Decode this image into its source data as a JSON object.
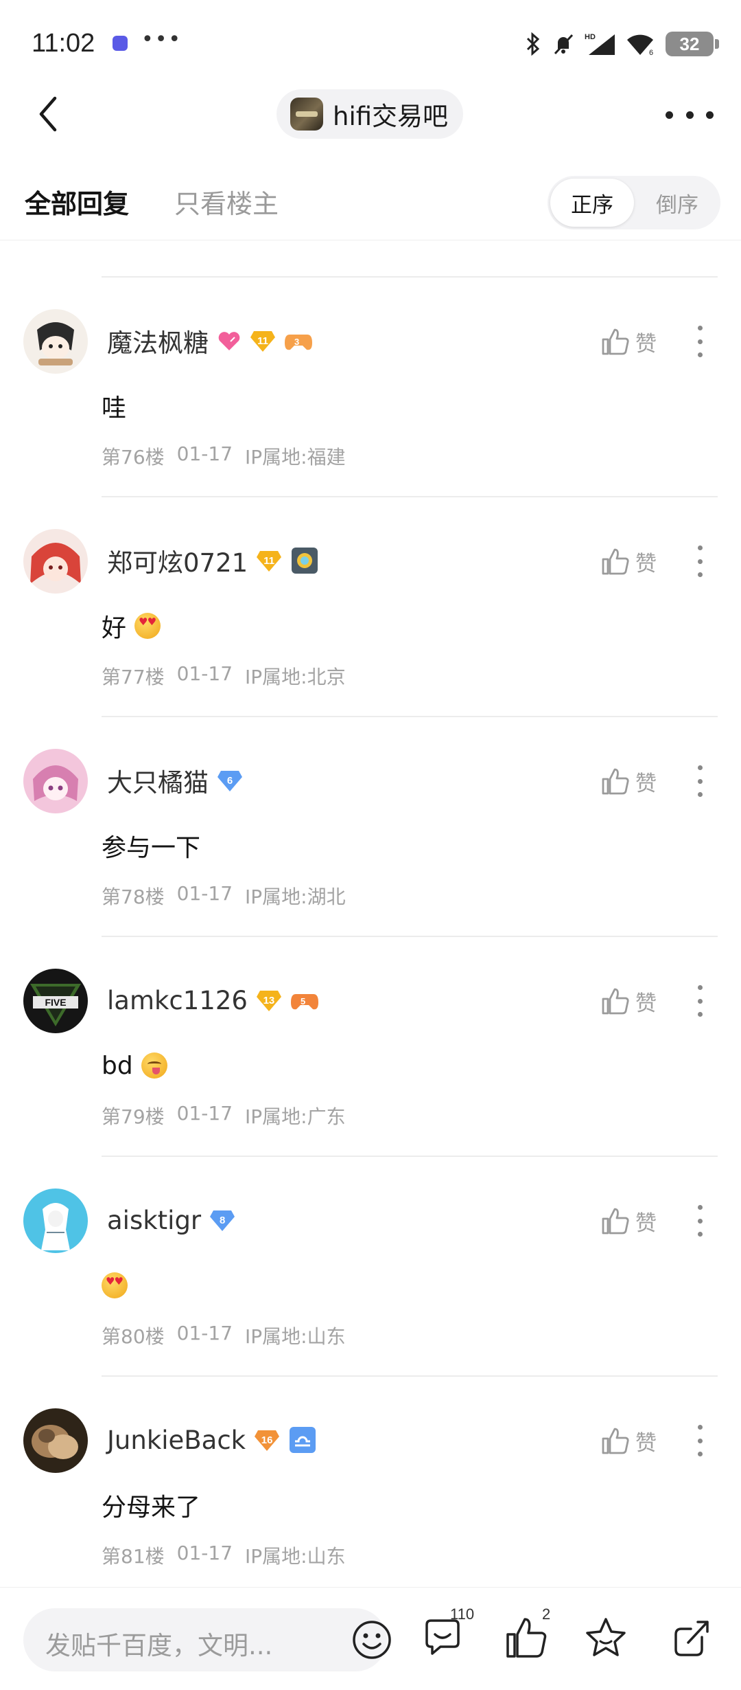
{
  "status_bar": {
    "time": "11:02",
    "dots": "•••",
    "battery": "32"
  },
  "nav": {
    "forum_name": "hifi交易吧"
  },
  "tabs": {
    "all_replies": "全部回复",
    "op_only": "只看楼主"
  },
  "sort": {
    "ascending": "正序",
    "descending": "倒序"
  },
  "posts": [
    {
      "username": "魔法枫糖",
      "level": "11",
      "content": "哇",
      "floor": "第76楼",
      "date": "01-17",
      "ip": "IP属地:福建",
      "like_label": "赞",
      "avatar_color": "#f2eee8",
      "extra_badge": "gamepad-badge",
      "extra_badge_value": "3"
    },
    {
      "username": "郑可炫0721",
      "level": "11",
      "content": "好",
      "floor": "第77楼",
      "date": "01-17",
      "ip": "IP属地:北京",
      "like_label": "赞",
      "avatar_color": "#d9443a",
      "extra_badge": "gear-badge",
      "content_emoji": "heart-eyes-emoji"
    },
    {
      "username": "大只橘猫",
      "level": "6",
      "content": "参与一下",
      "floor": "第78楼",
      "date": "01-17",
      "ip": "IP属地:湖北",
      "like_label": "赞",
      "avatar_color": "#e8a3c5"
    },
    {
      "username": "lamkc1126",
      "level": "13",
      "content": "bd",
      "floor": "第79楼",
      "date": "01-17",
      "ip": "IP属地:广东",
      "like_label": "赞",
      "avatar_color": "#1a1a1a",
      "extra_badge": "gamepad-badge",
      "extra_badge_value": "5",
      "content_emoji": "yum-emoji"
    },
    {
      "username": "aisktigr",
      "level": "8",
      "content": "",
      "floor": "第80楼",
      "date": "01-17",
      "ip": "IP属地:山东",
      "like_label": "赞",
      "avatar_color": "#4fc3e6",
      "content_emoji": "heart-eyes-emoji"
    },
    {
      "username": "JunkieBack",
      "level": "16",
      "content": "分母来了",
      "floor": "第81楼",
      "date": "01-17",
      "ip": "IP属地:山东",
      "like_label": "赞",
      "avatar_color": "#5a4632",
      "extra_badge": "libra-badge"
    }
  ],
  "bottom_bar": {
    "reply_placeholder": "发贴千百度，文明...",
    "comment_count": "110",
    "like_count": "2"
  },
  "colors": {
    "gold_badge": "#f5b31b",
    "blue_badge": "#5b9cf3",
    "orange_badge": "#f29238",
    "muted_text": "#a3a3a3"
  }
}
